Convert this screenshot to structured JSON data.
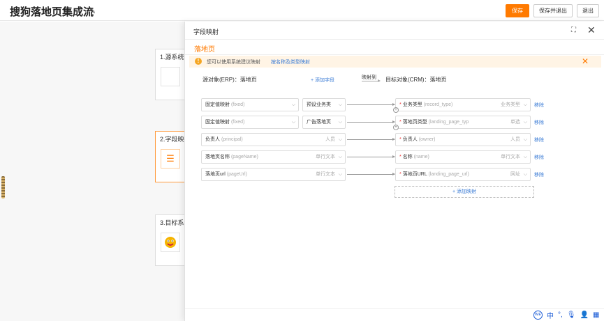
{
  "header": {
    "title": "搜狗落地页集成流",
    "save": "保存",
    "save_exit": "保存并退出",
    "exit": "退出"
  },
  "flow": {
    "cards": [
      {
        "title": "1.源系统"
      },
      {
        "title": "2.字段映射"
      },
      {
        "title": "3.目标系统"
      }
    ]
  },
  "drawer": {
    "title": "字段映射",
    "tab": "落地页",
    "notice": "您可以使用系统建议映射",
    "notice_link": "按名称及类型映射",
    "source_label": "源对象(ERP)：落地页",
    "add_field": "+ 添加字段",
    "map_to": "映射到",
    "target_label": "目标对象(CRM)：落地页",
    "remove": "移除",
    "add_mapping": "+ 添加映射"
  },
  "mappings": [
    {
      "src": "固定值映射",
      "src_hint": "(fixed)",
      "val": "预设业务类",
      "tgt": "业务类型",
      "tgt_hint": "(record_type)",
      "tgt_type": "业务类型"
    },
    {
      "src": "固定值映射",
      "src_hint": "(fixed)",
      "val": "广告落地页",
      "tgt": "落地页类型",
      "tgt_hint": "(landing_page_typ",
      "tgt_type": "单选"
    },
    {
      "src": "负责人",
      "src_hint": "(principal)",
      "src_type": "人员",
      "tgt": "负责人",
      "tgt_hint": "(owner)",
      "tgt_type": "人员"
    },
    {
      "src": "落地页名称",
      "src_hint": "(pageName)",
      "src_type": "单行文本",
      "tgt": "名称",
      "tgt_hint": "(name)",
      "tgt_type": "单行文本"
    },
    {
      "src": "落地页url",
      "src_hint": "(pageUrl)",
      "src_type": "单行文本",
      "tgt": "落地页URL",
      "tgt_hint": "(landing_page_url)",
      "tgt_type": "网址"
    }
  ],
  "tray": {
    "ime": "中"
  }
}
